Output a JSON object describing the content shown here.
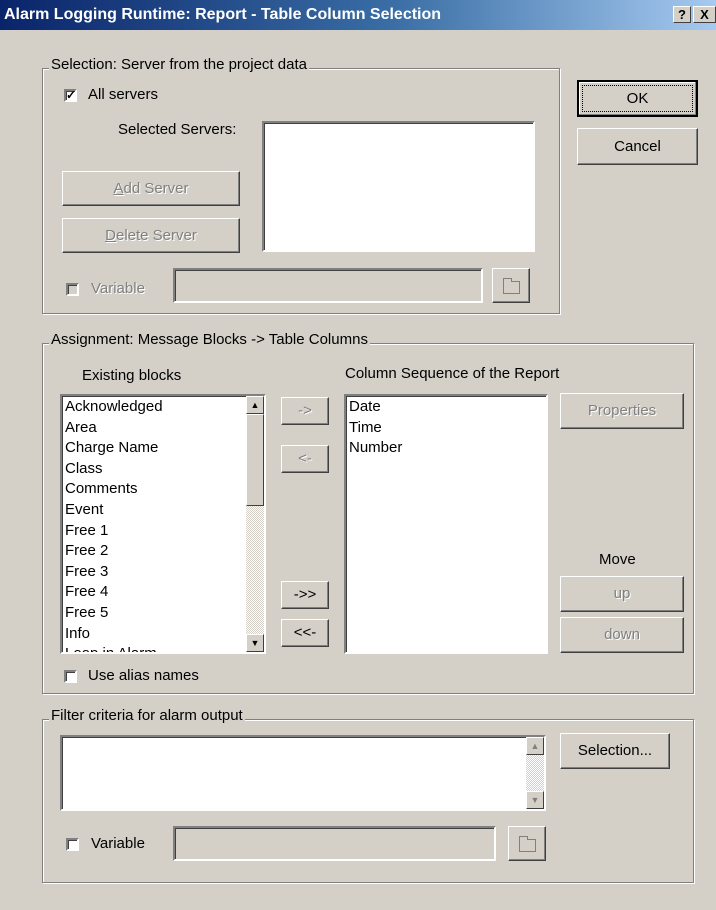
{
  "window": {
    "title": "Alarm Logging Runtime: Report - Table Column Selection",
    "help_btn": "?",
    "close_btn": "X"
  },
  "buttons": {
    "ok": "OK",
    "cancel": "Cancel"
  },
  "server_group": {
    "label": "Selection: Server from the project data",
    "all_servers_label": "All servers",
    "all_servers_checked": true,
    "selected_servers_label": "Selected Servers:",
    "add_server_label": "Add Server",
    "add_server_hotkey": "A",
    "add_server_rest": "dd Server",
    "delete_server_hotkey": "D",
    "delete_server_rest": "elete Server",
    "variable_label": "Variable",
    "variable_value": ""
  },
  "assignment_group": {
    "label": "Assignment: Message Blocks -> Table Columns",
    "existing_header": "Existing blocks",
    "existing_blocks": [
      "Acknowledged",
      "Area",
      "Charge Name",
      "Class",
      "Comments",
      "Event",
      "Free 1",
      "Free 2",
      "Free 3",
      "Free 4",
      "Free 5",
      "Info",
      "Loop in Alarm"
    ],
    "column_header": "Column Sequence of the Report",
    "columns": [
      "Date",
      "Time",
      "Number"
    ],
    "add_one": "->",
    "remove_one": "<-",
    "add_all": "->>",
    "remove_all": "<<-",
    "properties": "Properties",
    "move_label": "Move",
    "up": "up",
    "down": "down",
    "alias_label": "Use alias names"
  },
  "filter_group": {
    "label": "Filter criteria for alarm output",
    "selection_button": "Selection...",
    "variable_label": "Variable",
    "variable_value": ""
  }
}
